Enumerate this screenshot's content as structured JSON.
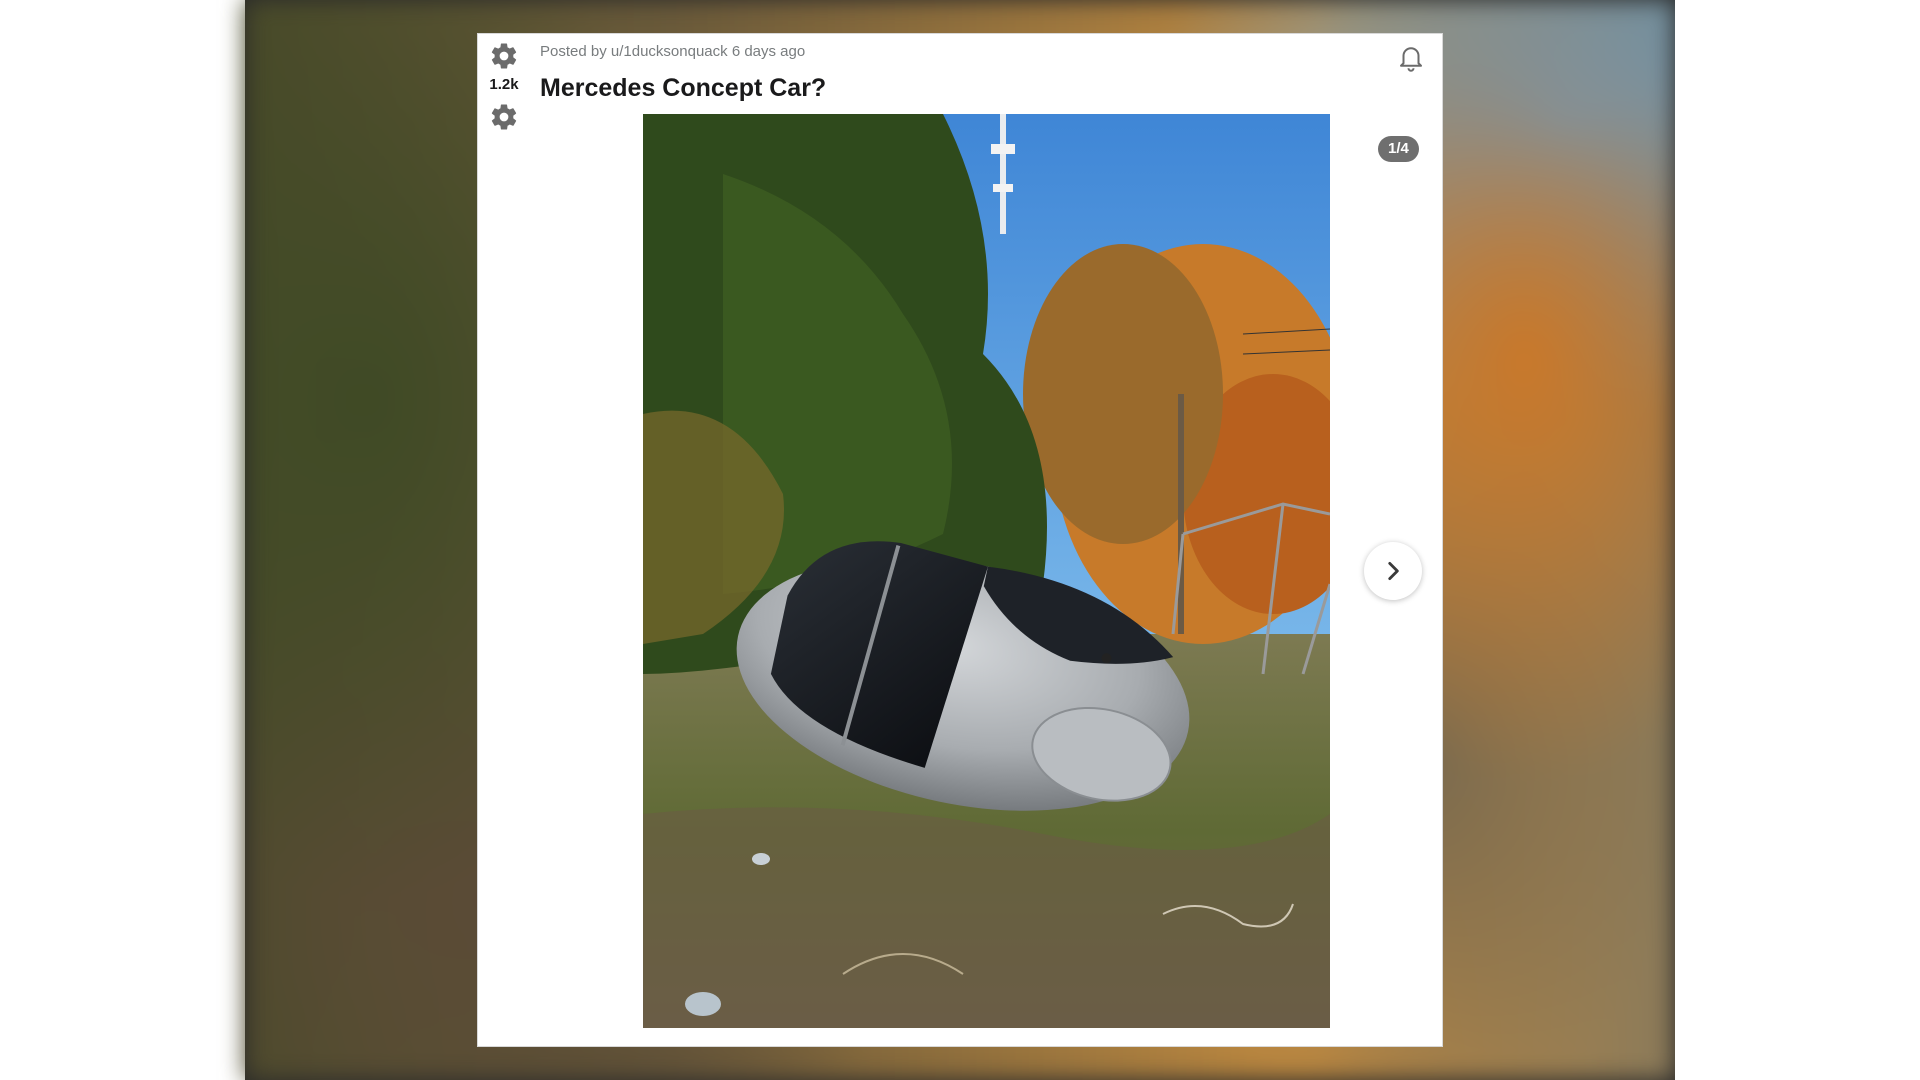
{
  "post": {
    "score": "1.2k",
    "posted_by_prefix": "Posted by",
    "username": "u/1ducksonquack",
    "age": "6 days ago",
    "title": "Mercedes Concept Car?"
  },
  "gallery": {
    "counter": "1/4"
  },
  "icons": {
    "upvote": "gear-icon",
    "downvote": "gear-icon",
    "notifications": "bell-icon",
    "next": "chevron-right-icon"
  },
  "colors": {
    "card_background": "#ffffff",
    "meta_text": "#787c7e",
    "title_text": "#1a1a1b",
    "counter_badge": "#6f6f6f",
    "sky": "#5a9fd8",
    "car_silver": "#b8bcc0"
  }
}
